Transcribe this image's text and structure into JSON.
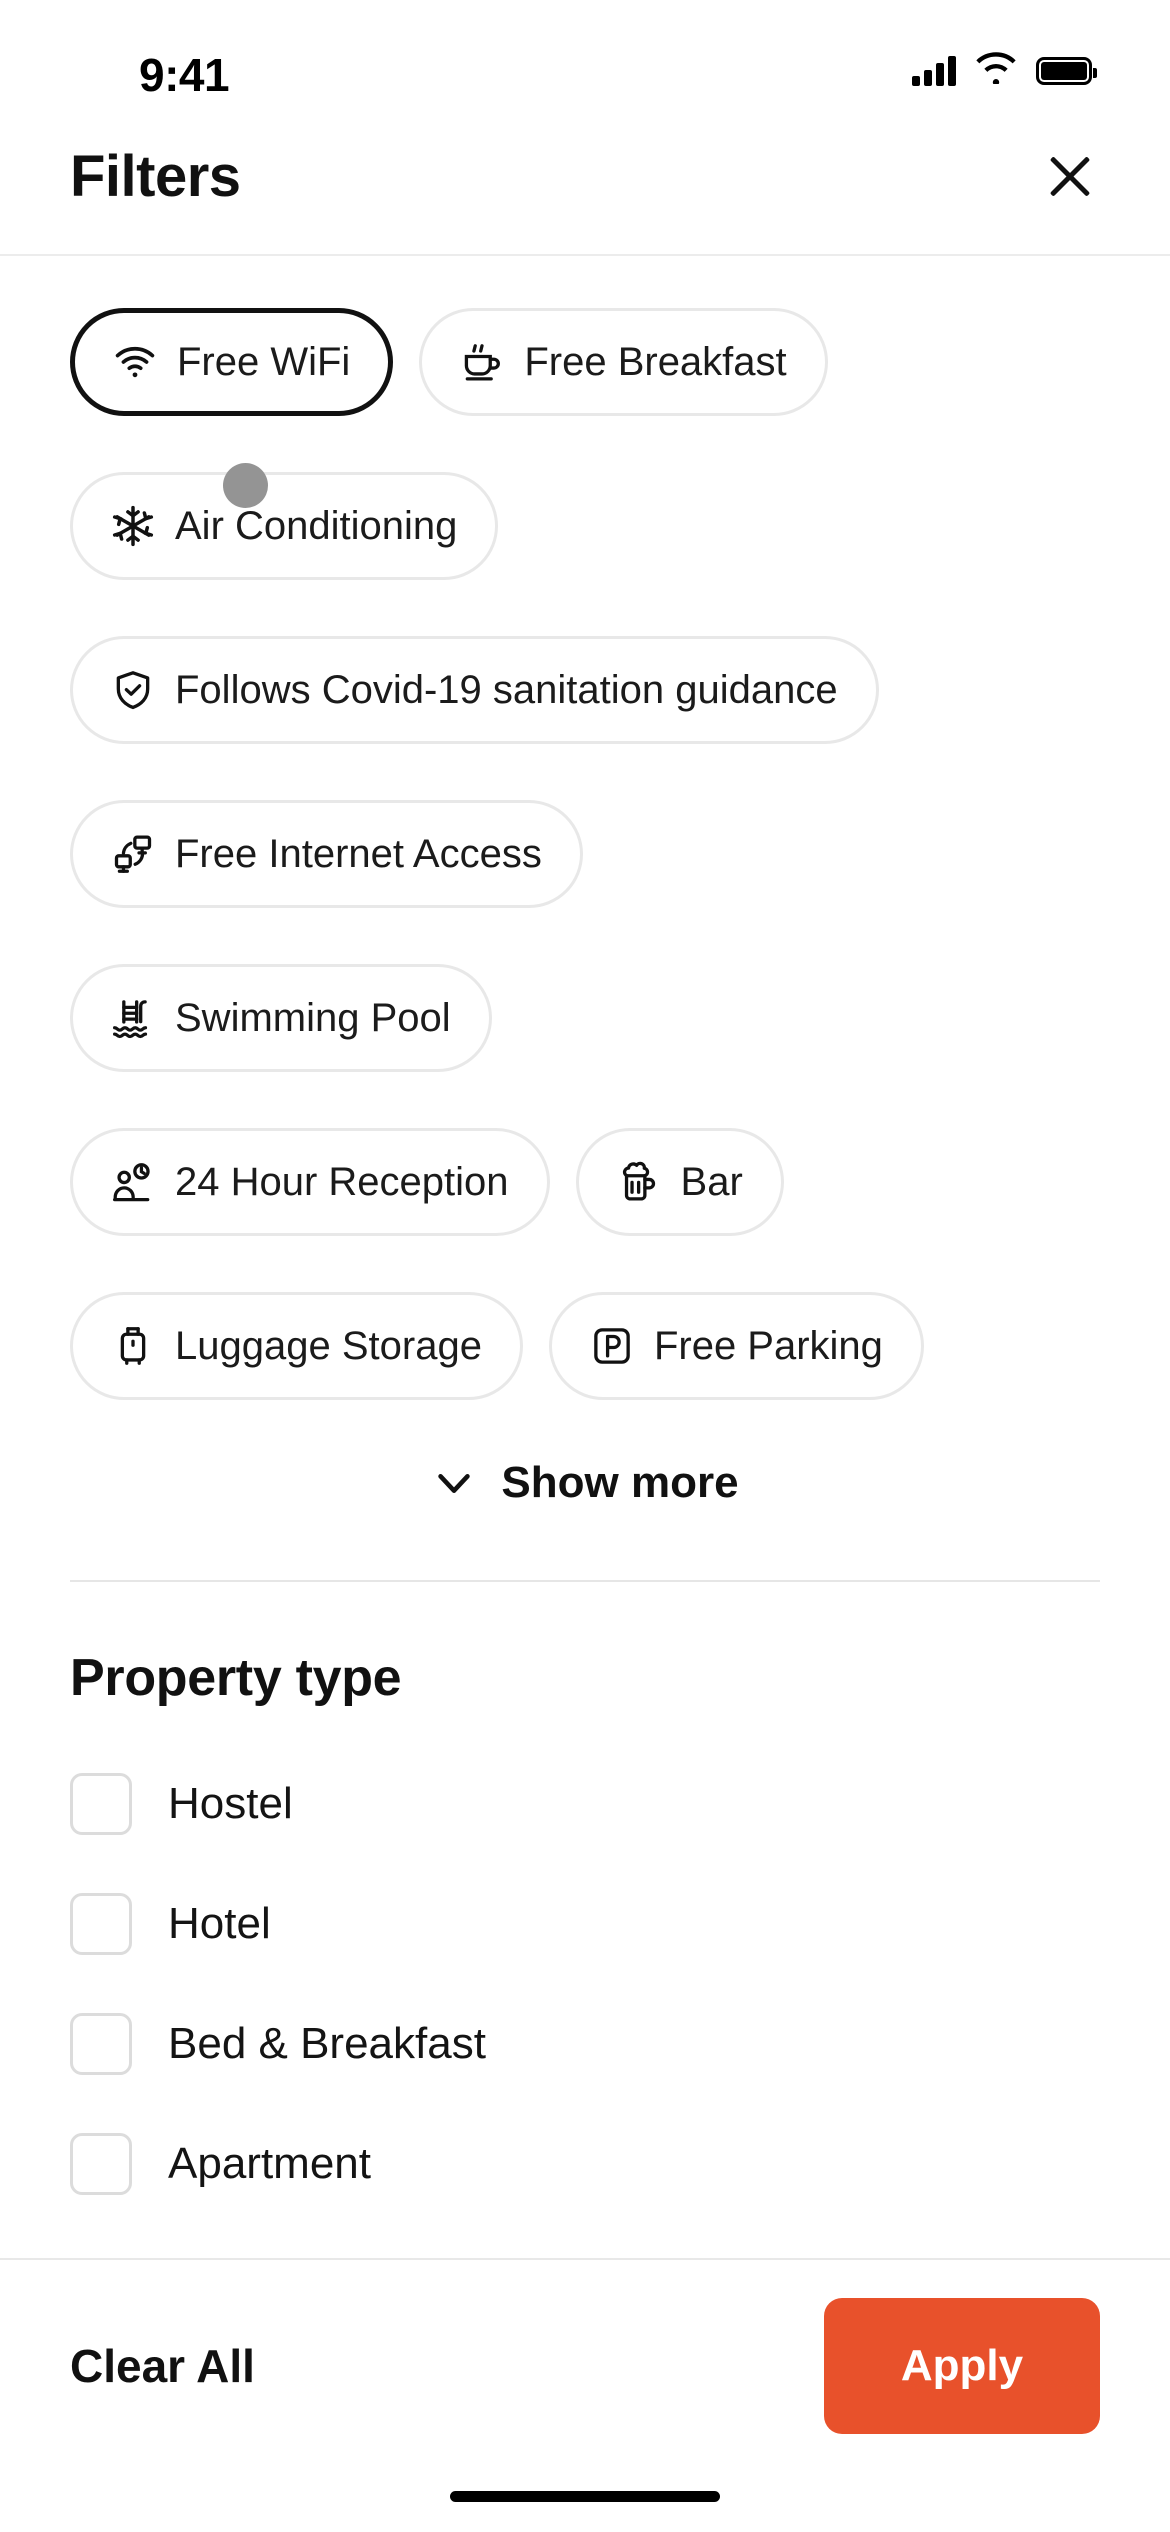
{
  "status_bar": {
    "time": "9:41",
    "cellular_icon": "signal-bars-icon",
    "wifi_icon": "wifi-icon",
    "battery_icon": "battery-full-icon"
  },
  "header": {
    "title": "Filters",
    "close_icon": "close-icon"
  },
  "amenities": {
    "chips": [
      {
        "label": "Free WiFi",
        "icon": "wifi-icon",
        "selected": true
      },
      {
        "label": "Free Breakfast",
        "icon": "coffee-cup-icon",
        "selected": false
      },
      {
        "label": "Air Conditioning",
        "icon": "snowflake-icon",
        "selected": false
      },
      {
        "label": "Follows Covid-19 sanitation guidance",
        "icon": "shield-check-icon",
        "selected": false
      },
      {
        "label": "Free Internet Access",
        "icon": "network-devices-icon",
        "selected": false
      },
      {
        "label": "Swimming Pool",
        "icon": "swimming-pool-icon",
        "selected": false
      },
      {
        "label": "24 Hour Reception",
        "icon": "person-clock-icon",
        "selected": false
      },
      {
        "label": "Bar",
        "icon": "beer-mug-icon",
        "selected": false
      },
      {
        "label": "Luggage Storage",
        "icon": "suitcase-icon",
        "selected": false
      },
      {
        "label": "Free Parking",
        "icon": "parking-p-icon",
        "selected": false
      }
    ],
    "show_more_label": "Show more",
    "show_more_icon": "chevron-down-icon"
  },
  "property_type": {
    "title": "Property type",
    "options": [
      {
        "label": "Hostel",
        "checked": false
      },
      {
        "label": "Hotel",
        "checked": false
      },
      {
        "label": "Bed & Breakfast",
        "checked": false
      },
      {
        "label": "Apartment",
        "checked": false
      }
    ]
  },
  "footer": {
    "clear_all_label": "Clear All",
    "apply_label": "Apply",
    "apply_color": "#e8512b"
  }
}
